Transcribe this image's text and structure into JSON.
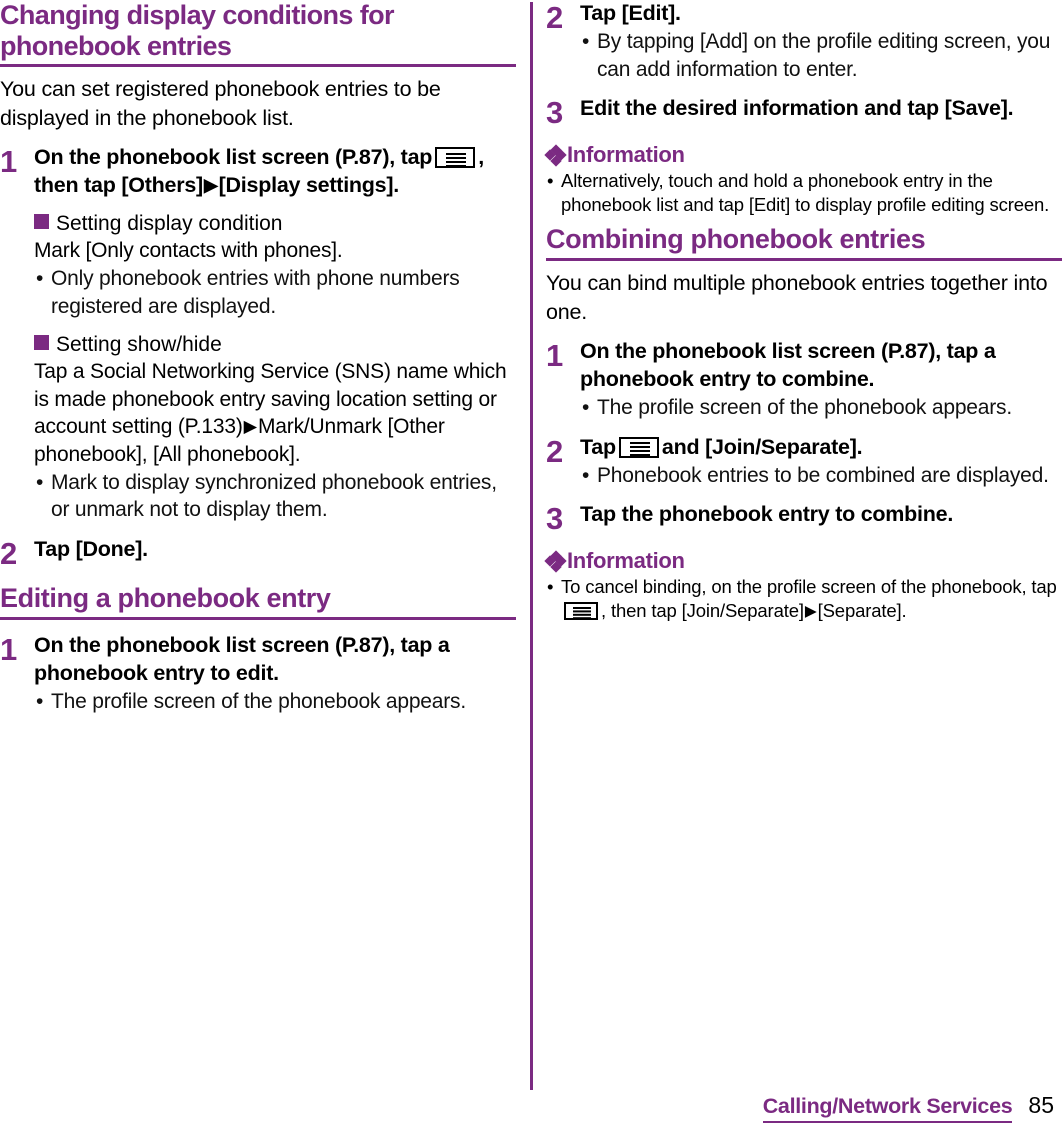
{
  "document": {
    "page_number": "85",
    "footer_title": "Calling/Network Services",
    "accent_color": "#7B2A82"
  },
  "left_column": {
    "section1": {
      "heading": "Changing display conditions for phonebook entries",
      "intro": "You can set registered phonebook entries to be displayed in the phonebook list.",
      "step1": {
        "number": "1",
        "title_part1": "On the phonebook list screen (P.87), tap",
        "icon": "menu-key-icon",
        "title_part2": ", then tap [Others]",
        "arrow": "▶",
        "title_part3": "[Display settings].",
        "sub1": {
          "square_bullet": "■",
          "heading": "Setting display condition",
          "text": "Mark [Only contacts with phones].",
          "bullets": [
            "Only phonebook entries with phone numbers registered are displayed."
          ]
        },
        "sub2": {
          "square_bullet": "■",
          "heading": "Setting show/hide",
          "text_part1": "Tap a Social Networking Service (SNS) name which is made phonebook entry saving location setting or account setting (P.133)",
          "arrow": "▶",
          "text_part2": "Mark/Unmark [Other phonebook], [All phonebook].",
          "bullets": [
            "Mark to display synchronized phonebook entries, or unmark not to display them."
          ]
        }
      },
      "step2": {
        "number": "2",
        "title": "Tap [Done]."
      }
    },
    "section2": {
      "heading": "Editing a phonebook entry",
      "step1": {
        "number": "1",
        "title": "On the phonebook list screen (P.87), tap a phonebook entry to edit.",
        "bullets": [
          "The profile screen of the phonebook appears."
        ]
      }
    }
  },
  "right_column": {
    "section2_cont": {
      "step2": {
        "number": "2",
        "title": "Tap [Edit].",
        "bullets": [
          "By tapping [Add] on the profile editing screen, you can add information to enter."
        ]
      },
      "step3": {
        "number": "3",
        "title": "Edit the desired information and tap [Save]."
      },
      "information": {
        "label": "Information",
        "glyph": "four-diamond-icon",
        "items": [
          "Alternatively, touch and hold a phonebook entry in the phonebook list and tap [Edit] to display profile editing screen."
        ]
      }
    },
    "section3": {
      "heading": "Combining phonebook entries",
      "intro": "You can bind multiple phonebook entries together into one.",
      "step1": {
        "number": "1",
        "title": "On the phonebook list screen (P.87), tap a phonebook entry to combine.",
        "bullets": [
          "The profile screen of the phonebook appears."
        ]
      },
      "step2": {
        "number": "2",
        "title_part1": "Tap",
        "icon": "menu-key-icon",
        "title_part2": "and [Join/Separate].",
        "bullets": [
          "Phonebook entries to be combined are displayed."
        ]
      },
      "step3": {
        "number": "3",
        "title": "Tap the phonebook entry to combine."
      },
      "information": {
        "label": "Information",
        "glyph": "four-diamond-icon",
        "item_part1": "To cancel binding, on the profile screen of the phonebook, tap",
        "icon": "menu-key-icon",
        "item_part2": ", then tap [Join/Separate]",
        "arrow": "▶",
        "item_part3": "[Separate]."
      }
    }
  }
}
